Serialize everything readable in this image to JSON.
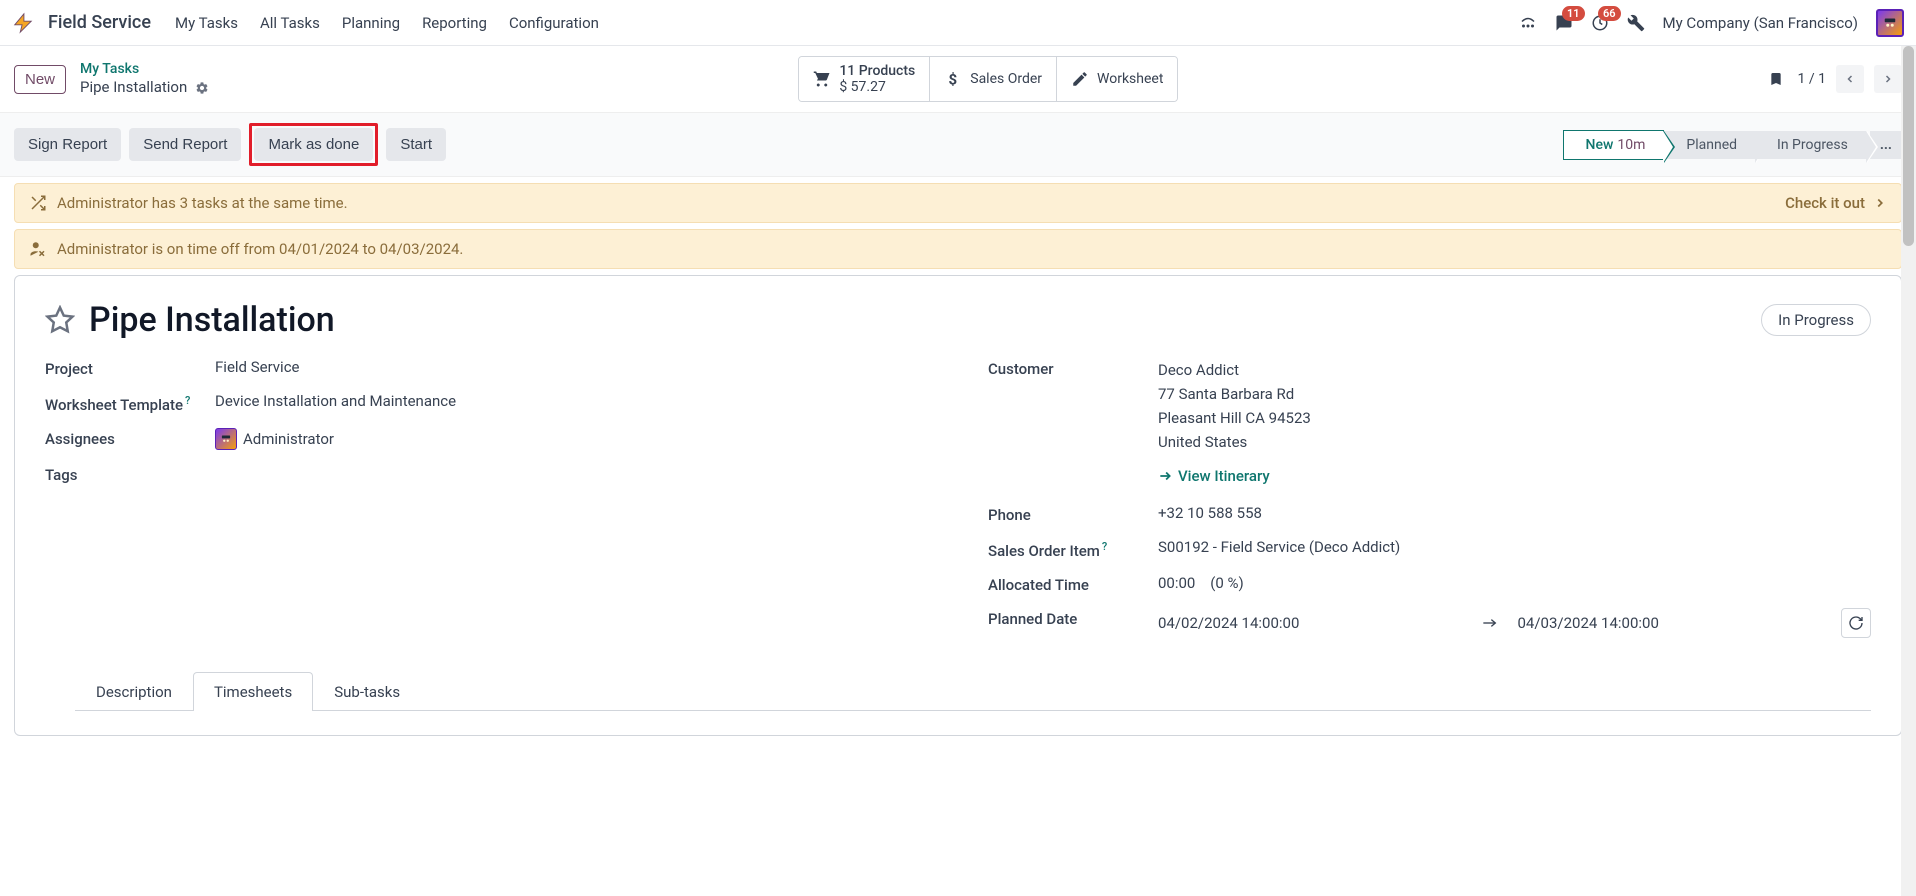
{
  "nav": {
    "brand": "Field Service",
    "menu": [
      "My Tasks",
      "All Tasks",
      "Planning",
      "Reporting",
      "Configuration"
    ],
    "badge_chat": "11",
    "badge_clock": "66",
    "company": "My Company (San Francisco)"
  },
  "controlbar": {
    "new_btn": "New",
    "breadcrumb_top": "My Tasks",
    "breadcrumb_bottom": "Pipe Installation",
    "products_line1": "11 Products",
    "products_line2": "$ 57.27",
    "sales_order_btn": "Sales Order",
    "worksheet_btn": "Worksheet",
    "pager": "1 / 1"
  },
  "actions": {
    "sign": "Sign Report",
    "send": "Send Report",
    "mark": "Mark as done",
    "start": "Start",
    "status_new": "New",
    "status_new_sub": "10m",
    "status_planned": "Planned",
    "status_inprogress": "In Progress",
    "more": "..."
  },
  "alerts": {
    "a1": "Administrator has 3 tasks at the same time.",
    "a1_link": "Check it out",
    "a2": "Administrator is on time off from 04/01/2024 to 04/03/2024."
  },
  "sheet": {
    "title": "Pipe Installation",
    "state_badge": "In Progress",
    "labels": {
      "project": "Project",
      "worksheet_template": "Worksheet Template",
      "assignees": "Assignees",
      "tags": "Tags",
      "customer": "Customer",
      "phone": "Phone",
      "sales_order_item": "Sales Order Item",
      "allocated_time": "Allocated Time",
      "planned_date": "Planned Date"
    },
    "values": {
      "project": "Field Service",
      "worksheet_template": "Device Installation and Maintenance",
      "assignees": "Administrator",
      "customer_name": "Deco Addict",
      "customer_street": "77 Santa Barbara Rd",
      "customer_city": "Pleasant Hill CA 94523",
      "customer_country": "United States",
      "itinerary": "View Itinerary",
      "phone": "+32 10 588 558",
      "sales_order_item": "S00192 - Field Service (Deco Addict)",
      "allocated_time": "00:00",
      "allocated_pct": "(0 %)",
      "planned_start": "04/02/2024 14:00:00",
      "planned_end": "04/03/2024 14:00:00"
    }
  },
  "tabs": {
    "description": "Description",
    "timesheets": "Timesheets",
    "subtasks": "Sub-tasks"
  }
}
